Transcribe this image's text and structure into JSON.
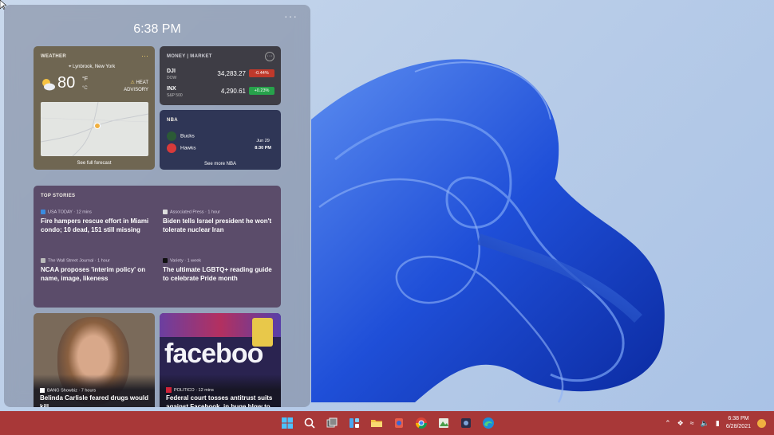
{
  "clock": "6:38 PM",
  "weather": {
    "label": "WEATHER",
    "location": "Lynbrook, New York",
    "temp": "80",
    "unit_f": "°F",
    "unit_c": "°C",
    "alert_line1": "HEAT",
    "alert_line2": "ADVISORY",
    "forecast_link": "See full forecast"
  },
  "money": {
    "label": "MONEY | MARKET",
    "rows": [
      {
        "symbol": "DJI",
        "sub": "DOW",
        "price": "34,283.27",
        "change": "-0.44%"
      },
      {
        "symbol": "INX",
        "sub": "S&P 500",
        "price": "4,290.61",
        "change": "+0.23%"
      }
    ]
  },
  "nba": {
    "label": "NBA",
    "team1": "Bucks",
    "team2": "Hawks",
    "date": "Jun 29",
    "time": "8:30 PM",
    "see_more": "See more NBA"
  },
  "stories": {
    "label": "TOP STORIES",
    "items": [
      {
        "source": "USA TODAY · 12 mins",
        "headline": "Fire hampers rescue effort in Miami condo; 10 dead, 151 still missing"
      },
      {
        "source": "Associated Press · 1 hour",
        "headline": "Biden tells Israel president he won't tolerate nuclear Iran"
      },
      {
        "source": "The Wall Street Journal · 1 hour",
        "headline": "NCAA proposes 'interim policy' on name, image, likeness"
      },
      {
        "source": "Variety · 1 week",
        "headline": "The ultimate LGBTQ+ reading guide to celebrate Pride month"
      }
    ]
  },
  "photo_cards": [
    {
      "source": "BANG Showbiz · 7 hours",
      "headline": "Belinda Carlisle feared drugs would kill"
    },
    {
      "source": "POLITICO · 12 mins",
      "headline": "Federal court tosses antitrust suits against Facebook, in huge blow to",
      "image_text": "faceboo"
    }
  ],
  "tray": {
    "time": "6:38 PM",
    "date": "6/28/2021"
  },
  "colors": {
    "taskbar": "#a83838",
    "accent_blue": "#1f4fd8"
  }
}
